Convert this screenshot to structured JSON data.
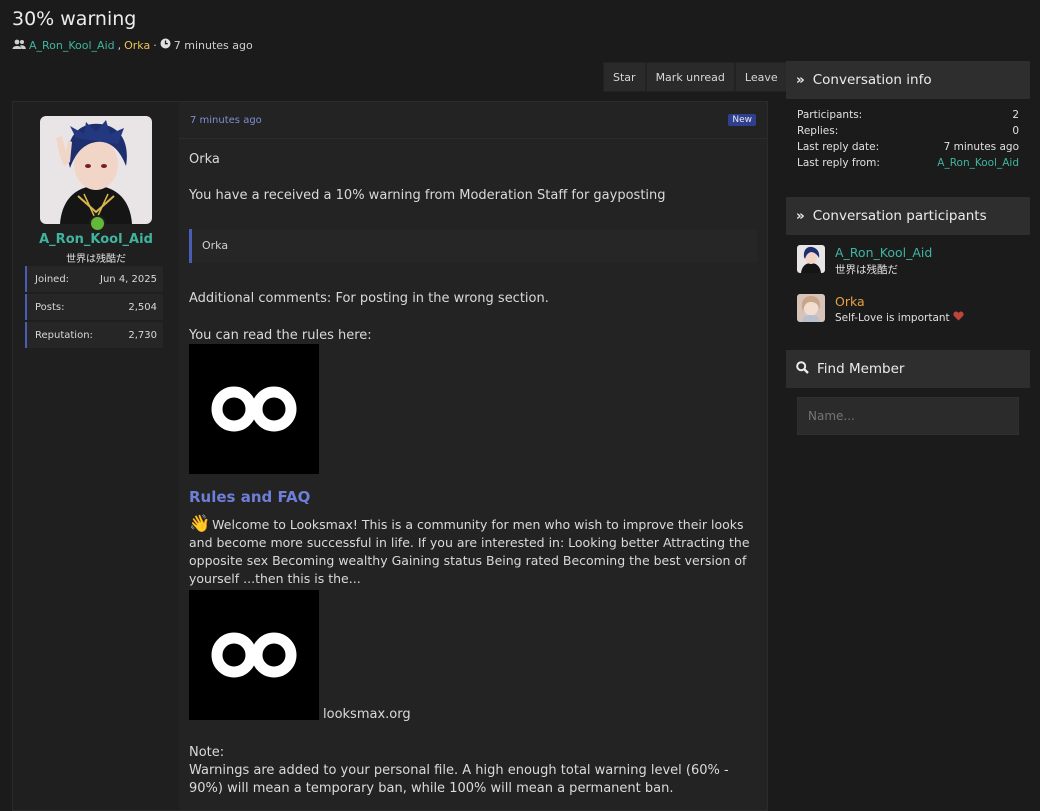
{
  "title": "30% warning",
  "meta": {
    "participant1": "A_Ron_Kool_Aid",
    "separator": ",",
    "participant2": "Orka",
    "dot": "·",
    "time": "7 minutes ago"
  },
  "actions": {
    "star": "Star",
    "mark_unread": "Mark unread",
    "leave": "Leave"
  },
  "author": {
    "name": "A_Ron_Kool_Aid",
    "title": "世界は残酷だ",
    "stats": [
      {
        "label": "Joined:",
        "value": "Jun 4, 2025"
      },
      {
        "label": "Posts:",
        "value": "2,504"
      },
      {
        "label": "Reputation:",
        "value": "2,730"
      }
    ]
  },
  "message": {
    "date": "7 minutes ago",
    "badge": "New",
    "greeting": "Orka",
    "line1": "You have a received a 10% warning from Moderation Staff for gayposting",
    "quote": "Orka",
    "comments": "Additional comments: For posting in the wrong section.",
    "rules_intro": "You can read the rules here:",
    "rules_link": "Rules and FAQ",
    "welcome_text": "Welcome to Looksmax! This is a community for men who wish to improve their looks and become more successful in life. If you are interested in: Looking better Attracting the opposite sex Becoming wealthy Gaining status Being rated Becoming the best version of yourself ...then this is the...",
    "site": "looksmax.org",
    "note_label": "Note:",
    "note_text": "Warnings are added to your personal file. A high enough total warning level (60% - 90%) will mean a temporary ban, while 100% will mean a permanent ban."
  },
  "sidebar": {
    "info_title": "Conversation info",
    "info": {
      "participants_label": "Participants:",
      "participants_value": "2",
      "replies_label": "Replies:",
      "replies_value": "0",
      "last_date_label": "Last reply date:",
      "last_date_value": "7 minutes ago",
      "last_from_label": "Last reply from:",
      "last_from_value": "A_Ron_Kool_Aid"
    },
    "participants_title": "Conversation participants",
    "participants": [
      {
        "name": "A_Ron_Kool_Aid",
        "subtitle": "世界は残酷だ",
        "color": "#3fb5a0"
      },
      {
        "name": "Orka",
        "subtitle": "Self-Love is important",
        "color": "#e8a040"
      }
    ],
    "find_title": "Find Member",
    "find_placeholder": "Name..."
  }
}
